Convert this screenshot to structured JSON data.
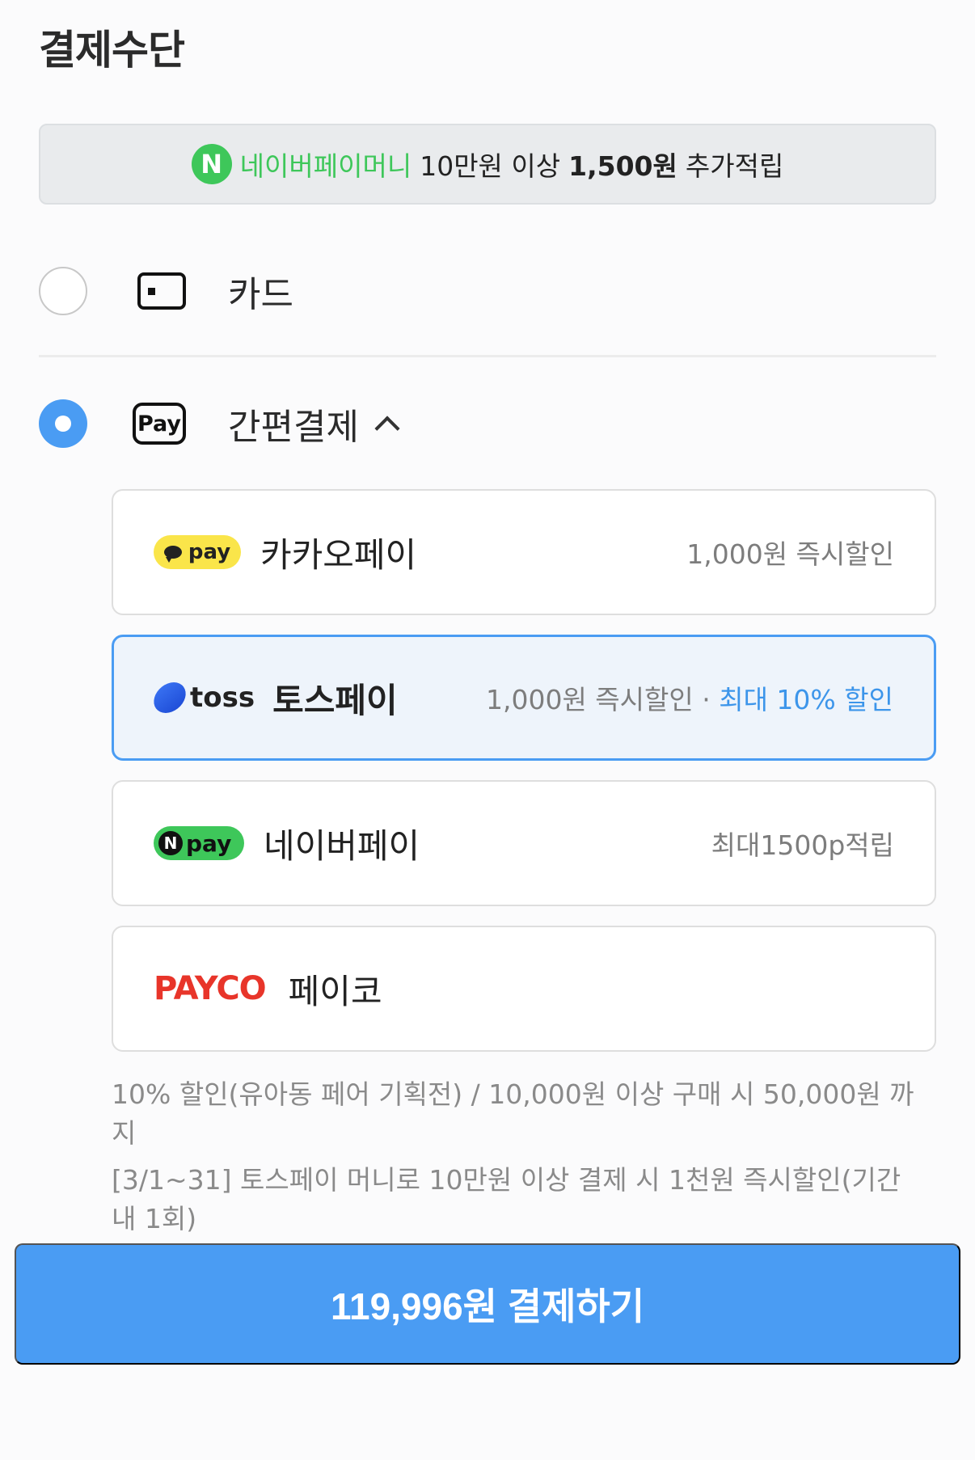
{
  "page_title": "결제수단",
  "promo": {
    "badge": "N",
    "brand": "네이버페이머니",
    "condition": "10만원 이상",
    "amount": "1,500원",
    "suffix": "추가적립"
  },
  "methods": {
    "card": {
      "label": "카드",
      "icon": "card-icon",
      "selected": false
    },
    "easy_pay": {
      "label": "간편결제",
      "icon": "pay-icon",
      "icon_text": "Pay",
      "selected": true,
      "expanded": true
    }
  },
  "pay_options": [
    {
      "id": "kakaopay",
      "logo_text": "pay",
      "name": "카카오페이",
      "benefit": "1,000원 즉시할인",
      "highlight": "",
      "selected": false
    },
    {
      "id": "tosspay",
      "logo_text": "toss",
      "name": "토스페이",
      "benefit": "1,000원 즉시할인 · ",
      "highlight": "최대 10% 할인",
      "selected": true
    },
    {
      "id": "naverpay",
      "logo_badge": "N",
      "logo_text": "pay",
      "name": "네이버페이",
      "benefit": "최대1500p적립",
      "highlight": "",
      "selected": false
    },
    {
      "id": "payco",
      "logo_text": "PAYCO",
      "name": "페이코",
      "benefit": "",
      "highlight": "",
      "selected": false
    }
  ],
  "notes": [
    "10% 할인(유아동 페어 기획전) / 10,000원 이상 구매 시 50,000원 까지",
    "[3/1~31] 토스페이 머니로 10만원 이상 결제 시 1천원 즉시할인(기간 내 1회)"
  ],
  "pay_button_label": "119,996원 결제하기",
  "colors": {
    "accent": "#4a9cf3",
    "naver_green": "#3ec75a",
    "kakao_yellow": "#fae54a",
    "payco_red": "#e8352a",
    "highlight_blue": "#3c95ea"
  }
}
